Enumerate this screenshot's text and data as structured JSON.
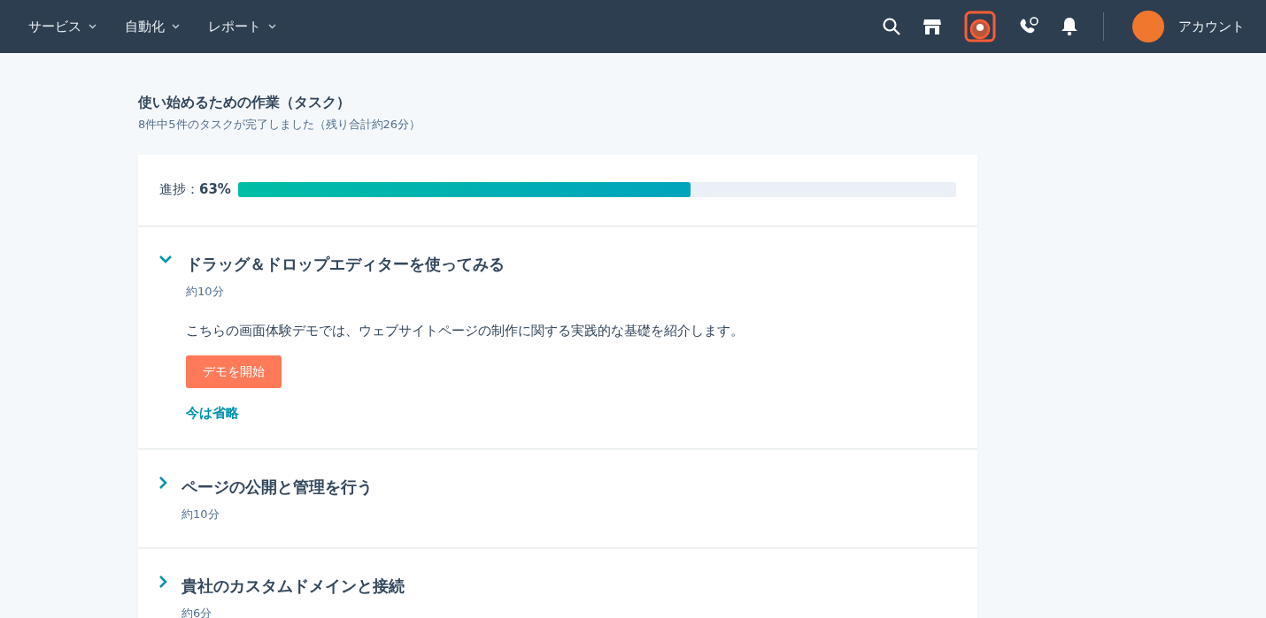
{
  "nav": {
    "menus": [
      {
        "label": "サービス"
      },
      {
        "label": "自動化"
      },
      {
        "label": "レポート"
      }
    ],
    "account": "アカウント"
  },
  "header": {
    "title": "使い始めるための作業（タスク）",
    "subtitle": "8件中5件のタスクが完了しました（残り合計約26分）"
  },
  "progress": {
    "label": "進捗：**63%**",
    "level": 0.63
  },
  "tasks": [
    {
      "title": "ドラッグ＆ドロップエディターを使ってみる",
      "duration": "約10分",
      "expanded": true,
      "description": "こちらの画面体験デモでは、ウェブサイトページの制作に関する実践的な基礎を紹介します。",
      "button": "デモを開始",
      "skip": "今は省略"
    },
    {
      "title": "ページの公開と管理を行う",
      "duration": "約10分",
      "expanded": false
    },
    {
      "title": "貴社のカスタムドメインと接続",
      "duration": "約6分",
      "expanded": false
    }
  ]
}
